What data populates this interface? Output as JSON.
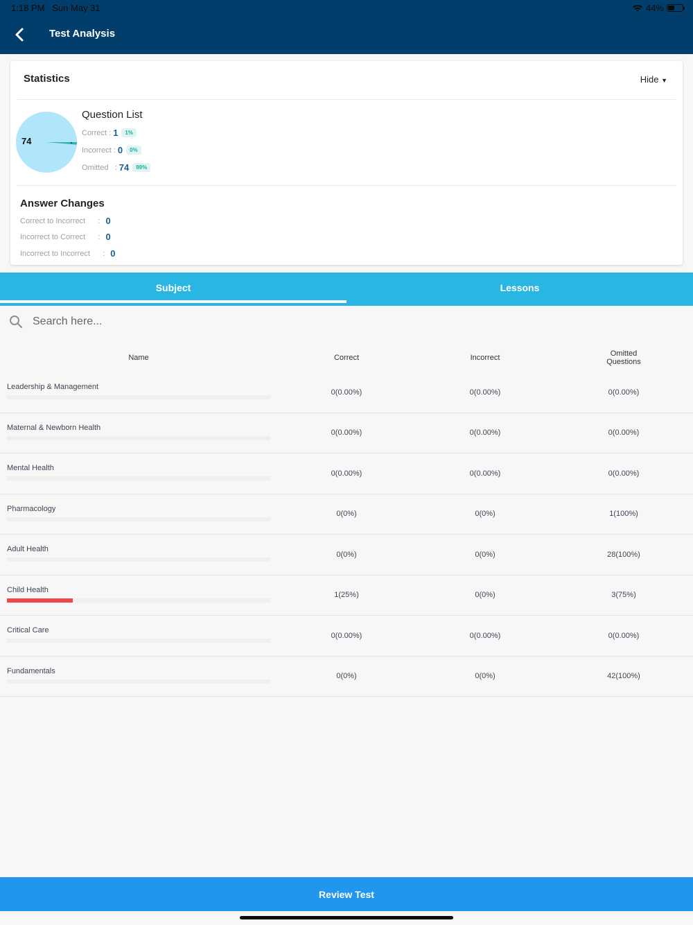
{
  "status_bar": {
    "time": "1:18 PM",
    "date": "Sun May 31",
    "battery": "44%",
    "battery_level": 0.44
  },
  "header": {
    "title": "Test Analysis",
    "back_icon": "chevron-left-icon"
  },
  "statistics": {
    "title": "Statistics",
    "toggle_label": "Hide",
    "toggle_icon": "triangle-down-icon",
    "pie": {
      "center_label": "74",
      "correct": 1,
      "incorrect": 0,
      "omitted": 74,
      "colors": {
        "omitted": "#b1e5fb",
        "correct": "#2bb5a3"
      }
    },
    "question_list": {
      "title": "Question List",
      "rows": [
        {
          "label": "Correct",
          "sep": ":",
          "value": "1",
          "badge": "1%"
        },
        {
          "label": "Incorrect",
          "sep": ":",
          "value": "0",
          "badge": "0%"
        },
        {
          "label": "Omitted",
          "sep": ":",
          "value": "74",
          "badge": "99%"
        }
      ]
    },
    "answer_changes": {
      "title": "Answer Changes",
      "rows": [
        {
          "label": "Correct to Incorrect",
          "sep": ":",
          "value": "0"
        },
        {
          "label": "Incorrect to Correct",
          "sep": ":",
          "value": "0"
        },
        {
          "label": "Incorrect to Incorrect",
          "sep": ":",
          "value": "0"
        }
      ]
    }
  },
  "tabs": [
    {
      "label": "Subject",
      "active": true
    },
    {
      "label": "Lessons",
      "active": false
    }
  ],
  "search": {
    "placeholder": "Search here...",
    "value": ""
  },
  "table": {
    "headers": {
      "name": "Name",
      "correct": "Correct",
      "incorrect": "Incorrect",
      "omitted_line1": "Omitted",
      "omitted_line2": "Questions"
    },
    "rows": [
      {
        "name": "Leadership & Management",
        "correct": "0(0.00%)",
        "incorrect": "0(0.00%)",
        "omitted": "0(0.00%)",
        "correct_fraction": 0
      },
      {
        "name": "Maternal & Newborn Health",
        "correct": "0(0.00%)",
        "incorrect": "0(0.00%)",
        "omitted": "0(0.00%)",
        "correct_fraction": 0
      },
      {
        "name": "Mental Health",
        "correct": "0(0.00%)",
        "incorrect": "0(0.00%)",
        "omitted": "0(0.00%)",
        "correct_fraction": 0
      },
      {
        "name": "Pharmacology",
        "correct": "0(0%)",
        "incorrect": "0(0%)",
        "omitted": "1(100%)",
        "correct_fraction": 0
      },
      {
        "name": "Adult Health",
        "correct": "0(0%)",
        "incorrect": "0(0%)",
        "omitted": "28(100%)",
        "correct_fraction": 0
      },
      {
        "name": "Child Health",
        "correct": "1(25%)",
        "incorrect": "0(0%)",
        "omitted": "3(75%)",
        "correct_fraction": 0.25
      },
      {
        "name": "Critical Care",
        "correct": "0(0.00%)",
        "incorrect": "0(0.00%)",
        "omitted": "0(0.00%)",
        "correct_fraction": 0
      },
      {
        "name": "Fundamentals",
        "correct": "0(0%)",
        "incorrect": "0(0%)",
        "omitted": "42(100%)",
        "correct_fraction": 0
      }
    ]
  },
  "footer": {
    "review_label": "Review Test"
  }
}
